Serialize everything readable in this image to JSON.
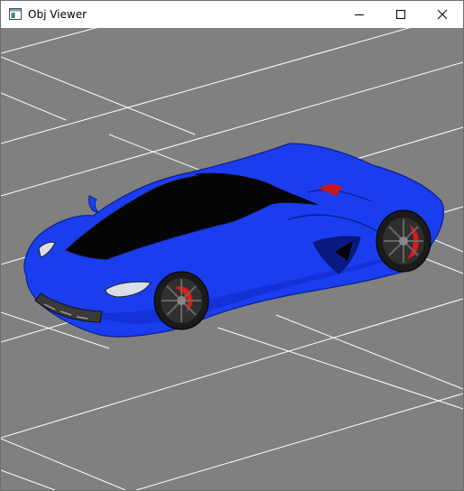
{
  "window": {
    "title": "Obj Viewer",
    "icon": "app-window-icon",
    "controls": [
      "minimize-icon",
      "maximize-icon",
      "close-icon"
    ]
  },
  "viewport": {
    "background_color": "#808080",
    "grid_color": "#ffffff",
    "model_color": "#1a3df0",
    "glass_color": "#050505",
    "caliper_color": "#e01818"
  }
}
